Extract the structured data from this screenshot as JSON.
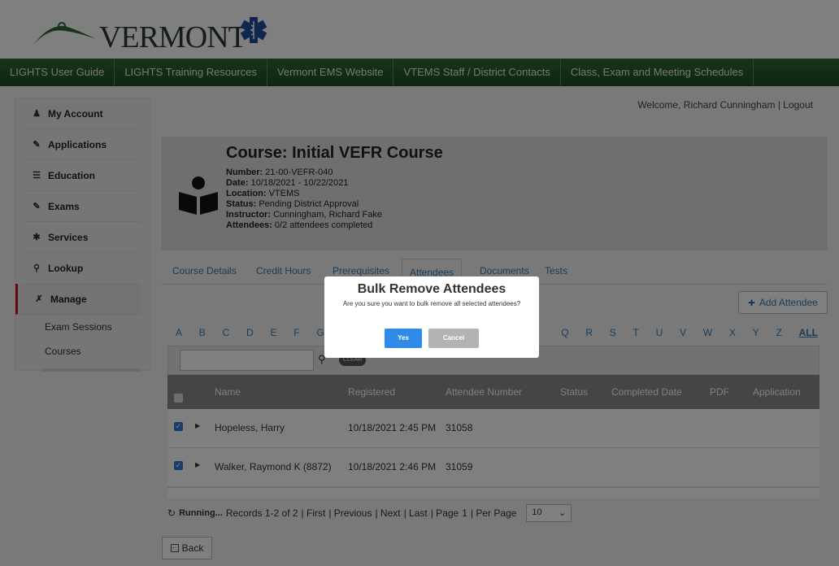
{
  "header": {
    "logo_text": "VERMONT"
  },
  "nav": [
    "LIGHTS User Guide",
    "LIGHTS Training Resources",
    "Vermont EMS Website",
    "VTEMS Staff / District Contacts",
    "Class, Exam and Meeting Schedules"
  ],
  "sidebar": {
    "items": [
      {
        "label": "My Account",
        "icon": "person-icon"
      },
      {
        "label": "Applications",
        "icon": "edit-icon"
      },
      {
        "label": "Education",
        "icon": "graduation-icon"
      },
      {
        "label": "Exams",
        "icon": "edit-icon"
      },
      {
        "label": "Services",
        "icon": "star-of-life-icon"
      },
      {
        "label": "Lookup",
        "icon": "search-icon"
      },
      {
        "label": "Manage",
        "icon": "wrench-icon"
      }
    ],
    "subitems": [
      "Exam Sessions",
      "Courses"
    ]
  },
  "welcome": "Welcome, Richard Cunningham | Logout",
  "course": {
    "title": "Course: Initial VEFR Course",
    "number_label": "Number:",
    "number": "21-00-VEFR-040",
    "date_label": "Date:",
    "date": "10/18/2021 - 10/22/2021",
    "location_label": "Location:",
    "location": "VTEMS",
    "status_label": "Status:",
    "status": "Pending District Approval",
    "instructor_label": "Instructor:",
    "instructor": "Cunningham, Richard Fake",
    "attendees_label": "Attendees:",
    "attendees": "0/2 attendees completed"
  },
  "tabs": [
    "Course Details",
    "Credit Hours",
    "Prerequisites",
    "Attendees",
    "Documents",
    "Tests"
  ],
  "add_attendee": "Add Attendee",
  "alphabet": [
    "A",
    "B",
    "C",
    "D",
    "E",
    "F",
    "G",
    "Q",
    "R",
    "S",
    "T",
    "U",
    "V",
    "W",
    "X",
    "Y",
    "Z"
  ],
  "alpha_all": "ALL",
  "filter": {
    "clear": "CLEAR"
  },
  "grid": {
    "columns": [
      "Name",
      "Registered",
      "Attendee Number",
      "Status",
      "Completed Date",
      "PDF",
      "Application"
    ],
    "rows": [
      {
        "name": "Hopeless, Harry",
        "registered": "10/18/2021 2:45 PM",
        "number": "31058",
        "checked": true
      },
      {
        "name": "Walker, Raymond K (8872)",
        "registered": "10/18/2021 2:46 PM",
        "number": "31059",
        "checked": true
      }
    ]
  },
  "pager": {
    "running": "Running...",
    "records": "Records 1-2 of 2",
    "first": "| First",
    "previous": "| Previous",
    "next": "| Next",
    "last": "| Last",
    "page_label": "| Page",
    "page": "1",
    "per_page_label": "| Per Page",
    "per_page": "10"
  },
  "back": "Back",
  "modal": {
    "title": "Bulk Remove Attendees",
    "message": "Are you sure you want to bulk remove all selected attendees?",
    "yes": "Yes",
    "cancel": "Cancel"
  },
  "colors": {
    "nav_green": "#2f6b34",
    "accent_blue": "#337ab7",
    "active_red": "#c8102e",
    "yes_blue": "#2f8ae8"
  }
}
